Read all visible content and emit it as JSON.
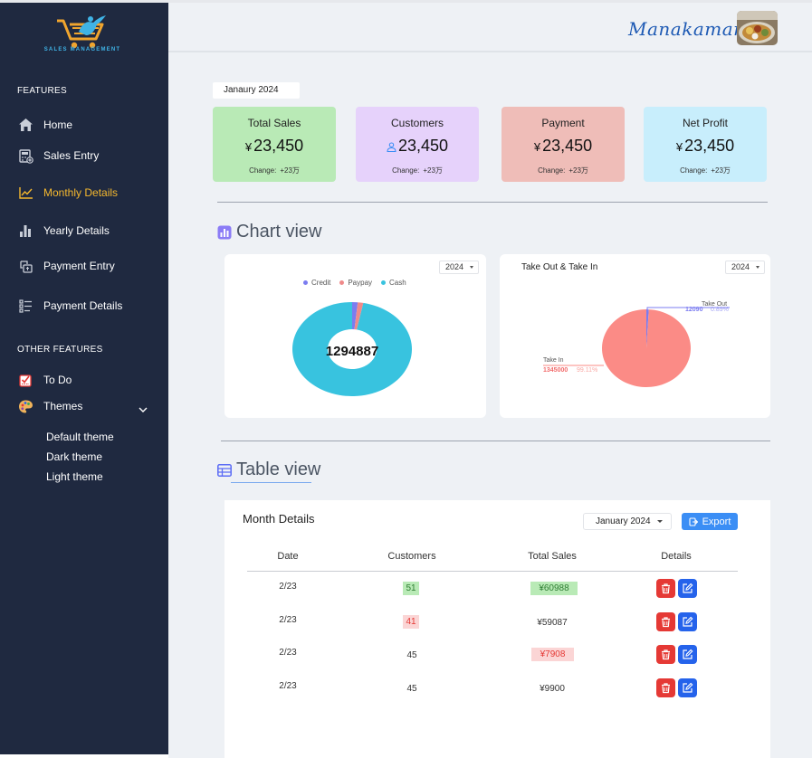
{
  "sidebar": {
    "logo_text": "SALES MANAGEMENT",
    "features_label": "FEATURES",
    "other_label": "OTHER FEATURES",
    "items": [
      {
        "label": "Home",
        "icon": "home-icon"
      },
      {
        "label": "Sales Entry",
        "icon": "calculator-icon"
      },
      {
        "label": "Monthly Details",
        "icon": "line-chart-icon",
        "active": true
      },
      {
        "label": "Yearly Details",
        "icon": "bar-chart-icon"
      },
      {
        "label": "Payment Entry",
        "icon": "payment-icon"
      },
      {
        "label": "Payment Details",
        "icon": "list-icon"
      }
    ],
    "other_items": [
      {
        "label": "To Do",
        "icon": "checklist-icon"
      },
      {
        "label": "Themes",
        "icon": "palette-icon"
      }
    ],
    "themes": [
      "Default theme",
      "Dark theme",
      "Light theme"
    ]
  },
  "header": {
    "brand": "Manakamana",
    "avatar": "food-avatar"
  },
  "period": "Janaury 2024",
  "stats": [
    {
      "title": "Total Sales",
      "currency": "¥",
      "value": "23,450",
      "change_label": "Change:",
      "change": "+23万",
      "color": "#b9eab6"
    },
    {
      "title": "Customers",
      "currency": "",
      "value": "23,450",
      "change_label": "Change:",
      "change": "+23万",
      "color": "#e6d2fb"
    },
    {
      "title": "Payment",
      "currency": "¥",
      "value": "23,450",
      "change_label": "Change:",
      "change": "+23万",
      "color": "#efbdb8"
    },
    {
      "title": "Net Profit",
      "currency": "¥",
      "value": "23,450",
      "change_label": "Change:",
      "change": "+23万",
      "color": "#c8eefc"
    }
  ],
  "chart_view": {
    "title": "Chart view",
    "year": "2024"
  },
  "chart_data": [
    {
      "type": "pie",
      "variant": "donut",
      "center_label": "1294887",
      "legend": [
        "Credit",
        "Paypay",
        "Cash"
      ],
      "series": [
        {
          "name": "Credit",
          "value": 1.5,
          "color": "#7b7cf0"
        },
        {
          "name": "Paypay",
          "value": 1.5,
          "color": "#ef8a8a"
        },
        {
          "name": "Cash",
          "value": 97,
          "color": "#38c3df"
        }
      ],
      "year": "2024"
    },
    {
      "type": "pie",
      "title": "Take Out & Take In",
      "year": "2024",
      "series": [
        {
          "name": "Take Out",
          "value": 12090,
          "percent": "0.89%",
          "color": "#7b7cf0"
        },
        {
          "name": "Take In",
          "value": 1345000,
          "percent": "99.11%",
          "color": "#fb8b86"
        }
      ],
      "labels": [
        {
          "name": "Take Out",
          "value": "12090",
          "percent": "0.89%"
        },
        {
          "name": "Take In",
          "value": "1345000",
          "percent": "99.11%"
        }
      ]
    }
  ],
  "table_view": {
    "title": "Table view",
    "card_title": "Month Details",
    "month_select": "January 2024",
    "export_label": "Export",
    "headers": [
      "Date",
      "Customers",
      "Total Sales",
      "Details"
    ],
    "rows": [
      {
        "date": "2/23",
        "customers": "51",
        "customers_badge": "green",
        "sales": "¥60988",
        "sales_badge": "green"
      },
      {
        "date": "2/23",
        "customers": "41",
        "customers_badge": "red",
        "sales": "¥59087",
        "sales_badge": "none"
      },
      {
        "date": "2/23",
        "customers": "45",
        "customers_badge": "none",
        "sales": "¥7908",
        "sales_badge": "red"
      },
      {
        "date": "2/23",
        "customers": "45",
        "customers_badge": "none",
        "sales": "¥9900",
        "sales_badge": "none"
      }
    ]
  }
}
